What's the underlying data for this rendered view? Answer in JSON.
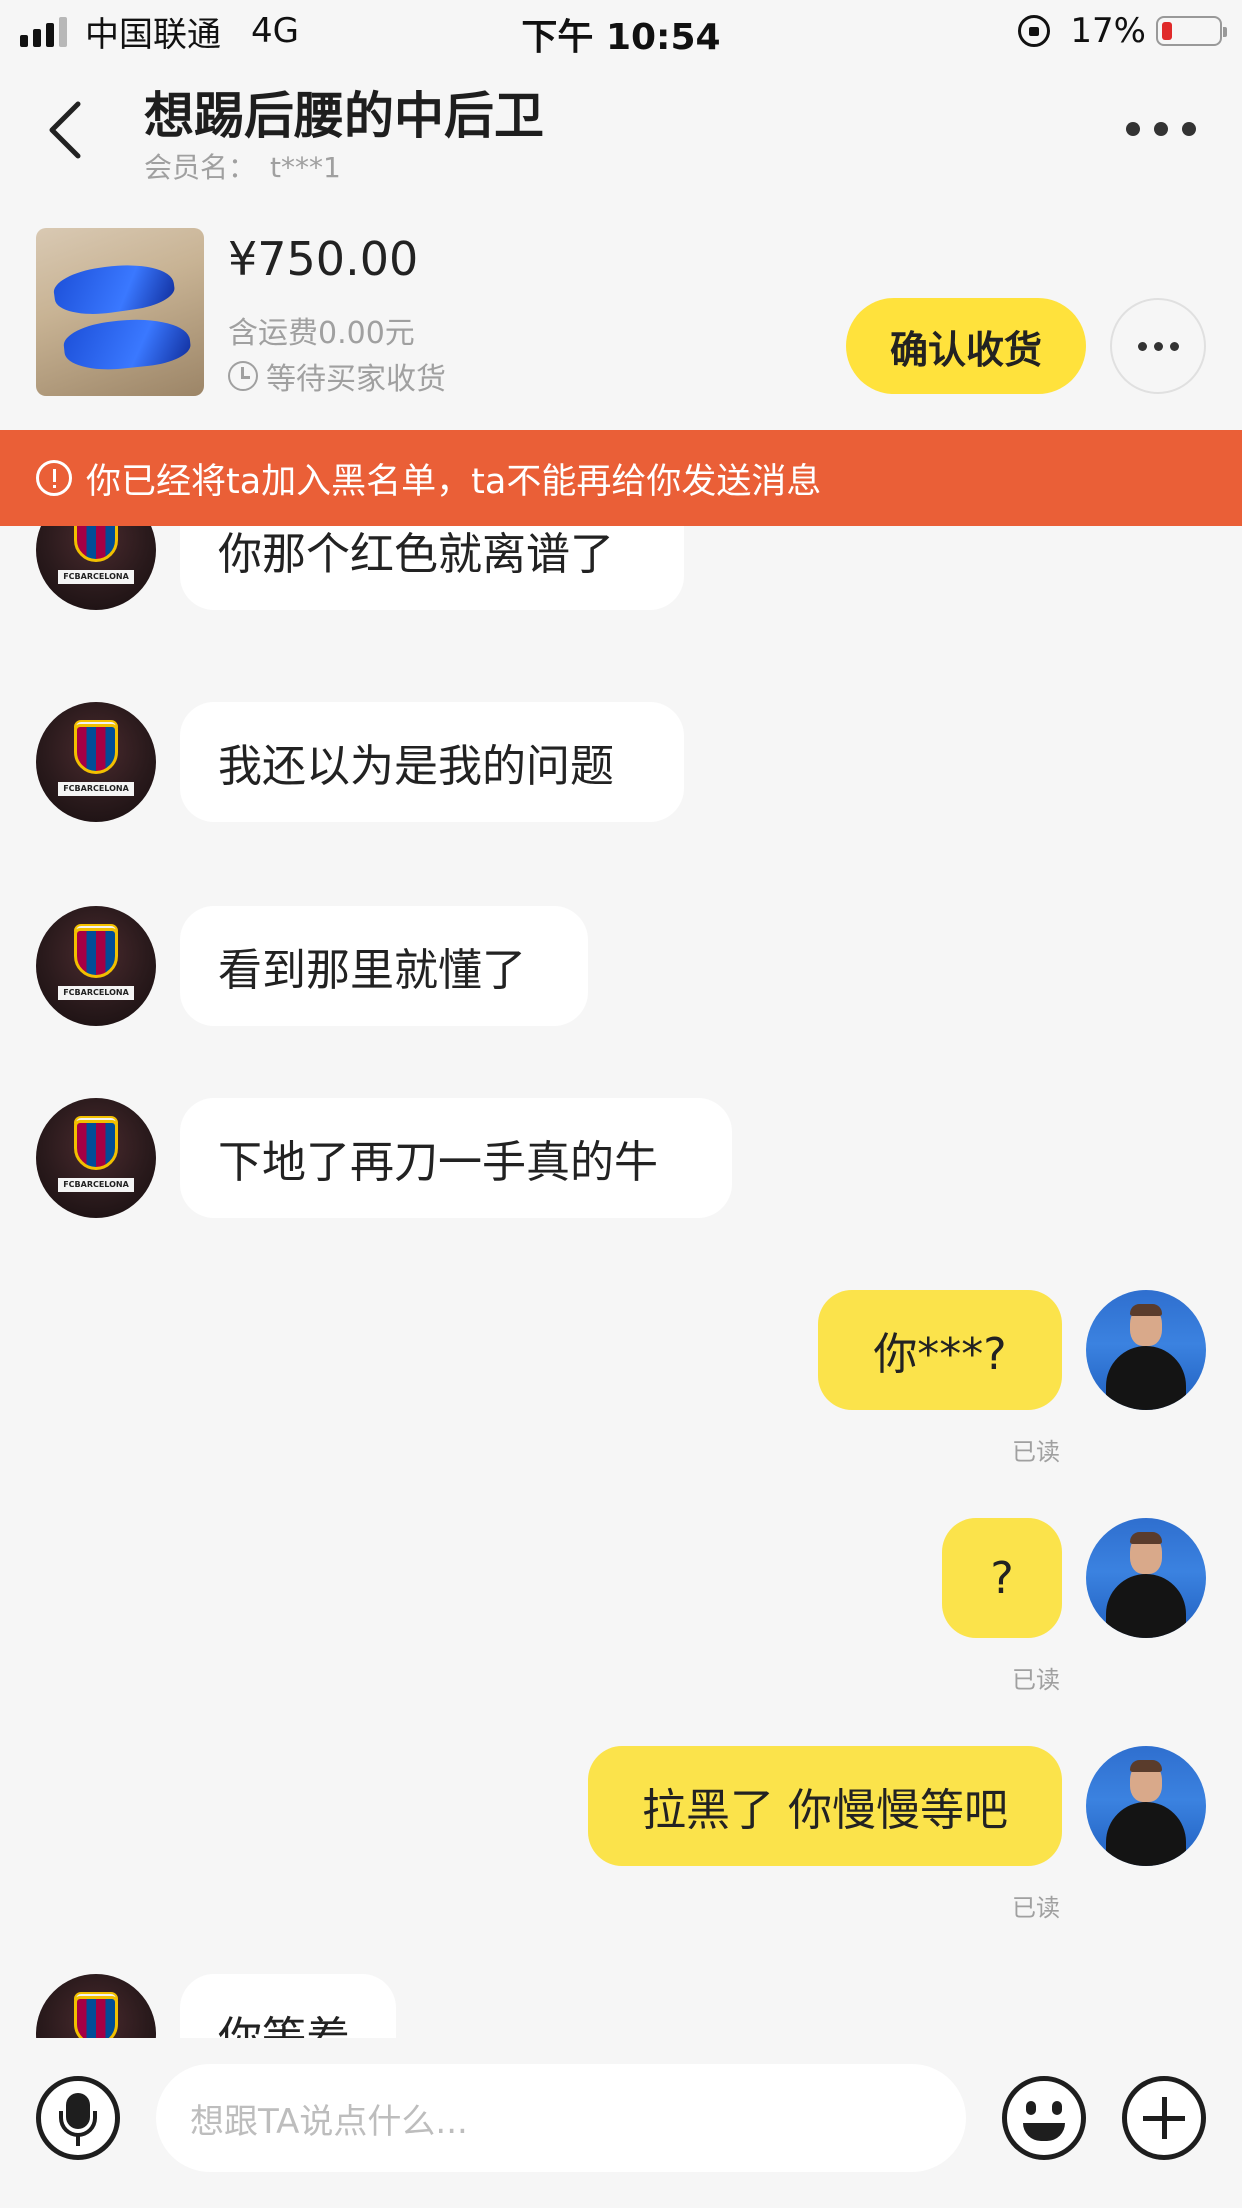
{
  "status_bar": {
    "carrier": "中国联通",
    "network": "4G",
    "time": "下午 10:54",
    "battery": "17%"
  },
  "header": {
    "title": "想踢后腰的中后卫",
    "member_label": "会员名：",
    "member_name": "t***1"
  },
  "product": {
    "price": "¥750.00",
    "shipping": "含运费0.00元",
    "status": "等待买家收货",
    "confirm_label": "确认收货"
  },
  "banner": {
    "text": "你已经将ta加入黑名单，ta不能再给你发送消息"
  },
  "messages": [
    {
      "side": "in",
      "text": "你那个红色就离谱了"
    },
    {
      "side": "in",
      "text": "我还以为是我的问题"
    },
    {
      "side": "in",
      "text": "看到那里就懂了"
    },
    {
      "side": "in",
      "text": "下地了再刀一手真的牛"
    },
    {
      "side": "out",
      "text": "你***?",
      "status": "已读"
    },
    {
      "side": "out",
      "text": "?",
      "status": "已读"
    },
    {
      "side": "out",
      "text": "拉黑了 你慢慢等吧",
      "status": "已读"
    },
    {
      "side": "in",
      "text": "你等着"
    }
  ],
  "avatar_labels": {
    "barca": "FCBARCELONA"
  },
  "input": {
    "placeholder": "想跟TA说点什么..."
  },
  "colors": {
    "accent_yellow": "#ffe23c",
    "banner_orange": "#ea5f37",
    "out_bubble": "#fbe34b"
  }
}
